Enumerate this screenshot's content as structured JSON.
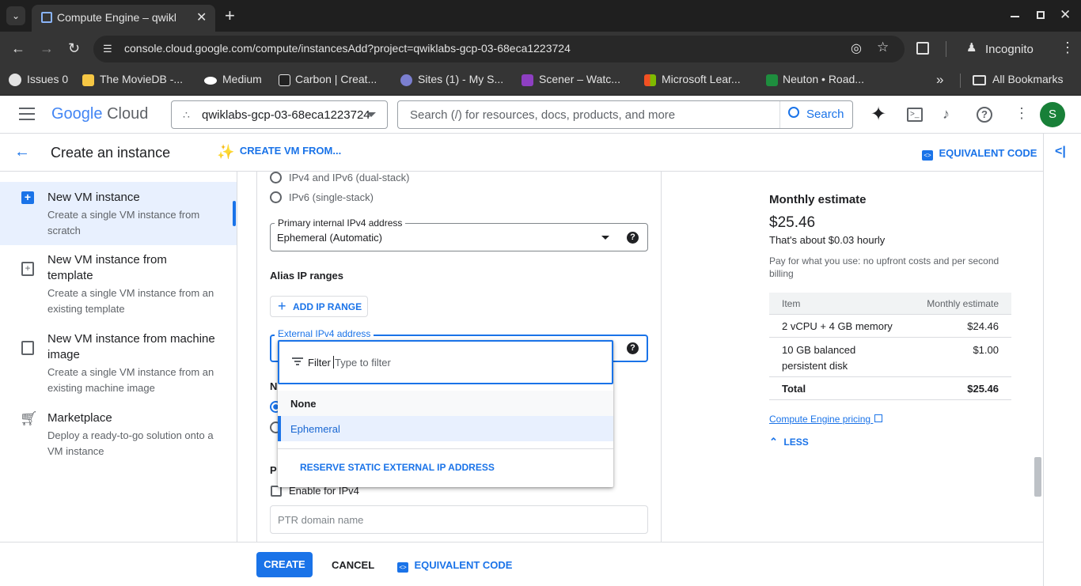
{
  "browser": {
    "tab_title": "Compute Engine – qwikla",
    "url": "console.cloud.google.com/compute/instancesAdd?project=qwiklabs-gcp-03-68eca1223724",
    "incognito_label": "Incognito",
    "bookmarks": [
      "Issues 0",
      "The MovieDB -...",
      "Medium",
      "Carbon | Creat...",
      "Sites (1) - My S...",
      "Scener – Watc...",
      "Microsoft Lear...",
      "Neuton • Road..."
    ],
    "all_bookmarks": "All Bookmarks"
  },
  "header": {
    "logo_google": "Google",
    "logo_cloud": "Cloud",
    "project": "qwiklabs-gcp-03-68eca1223724",
    "search_placeholder": "Search (/) for resources, docs, products, and more",
    "search_button": "Search",
    "avatar_letter": "S"
  },
  "subheader": {
    "title": "Create an instance",
    "create_from": "CREATE VM FROM...",
    "equivalent_code": "EQUIVALENT CODE"
  },
  "nav": {
    "items": [
      {
        "title": "New VM instance",
        "desc1": "Create a single VM instance from",
        "desc2": "scratch"
      },
      {
        "title1": "New VM instance from",
        "title2": "template",
        "desc1": "Create a single VM instance from an",
        "desc2": "existing template"
      },
      {
        "title1": "New VM instance from machine",
        "title2": "image",
        "desc1": "Create a single VM instance from an",
        "desc2": "existing machine image"
      },
      {
        "title": "Marketplace",
        "desc1": "Deploy a ready-to-go solution onto a",
        "desc2": "VM instance"
      }
    ]
  },
  "form": {
    "radio_dual": "IPv4 and IPv6 (dual-stack)",
    "radio_single": "IPv6 (single-stack)",
    "primary_ip_label": "Primary internal IPv4 address",
    "primary_ip_value": "Ephemeral (Automatic)",
    "alias_heading": "Alias IP ranges",
    "add_ip_range": "ADD IP RANGE",
    "external_label": "External IPv4 address",
    "partial_n": "N",
    "partial_p": "P",
    "enable_ipv4": "Enable for IPv4",
    "ptr_placeholder": "PTR domain name"
  },
  "dropdown": {
    "filter_label": "Filter",
    "filter_placeholder": "Type to filter",
    "options": [
      "None",
      "Ephemeral"
    ],
    "selected": "Ephemeral",
    "reserve": "RESERVE STATIC EXTERNAL IP ADDRESS"
  },
  "estimate": {
    "title": "Monthly estimate",
    "price": "$25.46",
    "hourly": "That's about $0.03 hourly",
    "note1": "Pay for what you use: no upfront costs and per second",
    "note2": "billing",
    "col_item": "Item",
    "col_est": "Monthly estimate",
    "rows": [
      {
        "item": "2 vCPU + 4 GB memory",
        "cost": "$24.46"
      },
      {
        "item1": "10 GB balanced",
        "item2": "persistent disk",
        "cost": "$1.00"
      }
    ],
    "total_label": "Total",
    "total": "$25.46",
    "pricing_link": "Compute Engine pricing",
    "less": "LESS"
  },
  "footer": {
    "create": "CREATE",
    "cancel": "CANCEL",
    "equivalent_code": "EQUIVALENT CODE"
  },
  "colors": {
    "accent": "#1a73e8",
    "chrome_dark": "#1f1f1f"
  }
}
